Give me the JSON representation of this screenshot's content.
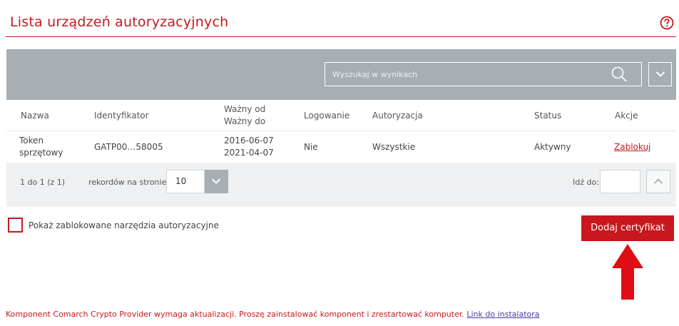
{
  "header": {
    "title": "Lista urządzeń autoryzacyjnych",
    "help_icon": "help-circle-icon"
  },
  "search": {
    "placeholder": "Wyszukaj w wynikach",
    "icon": "search-icon"
  },
  "table": {
    "columns": {
      "name": "Nazwa",
      "identifier": "Identyfikator",
      "valid_from": "Ważny od",
      "valid_to": "Ważny do",
      "login": "Logowanie",
      "authorization": "Autoryzacja",
      "status": "Status",
      "actions": "Akcje"
    },
    "rows": [
      {
        "name_line1": "Token",
        "name_line2": "sprzętowy",
        "identifier": "GATP00…58005",
        "valid_from": "2016-06-07",
        "valid_to": "2021-04-07",
        "login": "Nie",
        "authorization": "Wszystkie",
        "status": "Aktywny",
        "action": "Zablokuj"
      }
    ]
  },
  "pager": {
    "range": "1 do 1 (z 1)",
    "per_page_label": "rekordów na stronie",
    "per_page_value": "10",
    "goto_label": "Idź do:"
  },
  "options": {
    "show_blocked_label": "Pokaż zablokowane narzędzia autoryzacyjne"
  },
  "actions": {
    "add_certificate": "Dodaj certyfikat"
  },
  "footer": {
    "message": "Komponent Comarch Crypto Provider wymaga aktualizacji. Proszę zainstalować komponent i zrestartować komputer.",
    "link": "Link do instalatora"
  },
  "colors": {
    "accent": "#c8171e",
    "toolbar": "#a7aeb4",
    "pager_bg": "#eef0f1"
  }
}
